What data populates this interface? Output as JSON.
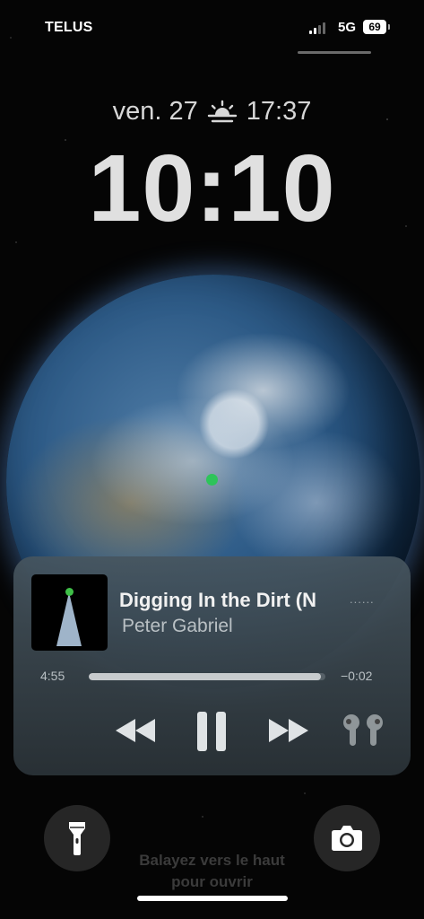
{
  "status_bar": {
    "carrier": "TELUS",
    "network": "5G",
    "battery": "69",
    "signal_bars_active": 2,
    "signal_bars_total": 4
  },
  "lockscreen": {
    "date": "ven. 27",
    "sunset_time": "17:37",
    "clock": "10:10"
  },
  "now_playing": {
    "title": "Digging In the Dirt (N",
    "artist": "Peter Gabriel",
    "title_overflow_dots": "......",
    "elapsed": "4:55",
    "remaining": "−0:02",
    "progress_fraction": 0.98,
    "icons": {
      "rewind": "rewind-icon",
      "pause": "pause-icon",
      "fast_forward": "fast-forward-icon",
      "airpods": "airpods-icon"
    }
  },
  "bottom": {
    "hint_line1": "Balayez vers le haut",
    "hint_line2": "pour ouvrir",
    "icons": {
      "flashlight": "flashlight-icon",
      "camera": "camera-icon"
    }
  },
  "colors": {
    "location_dot": "#2ec45a"
  }
}
